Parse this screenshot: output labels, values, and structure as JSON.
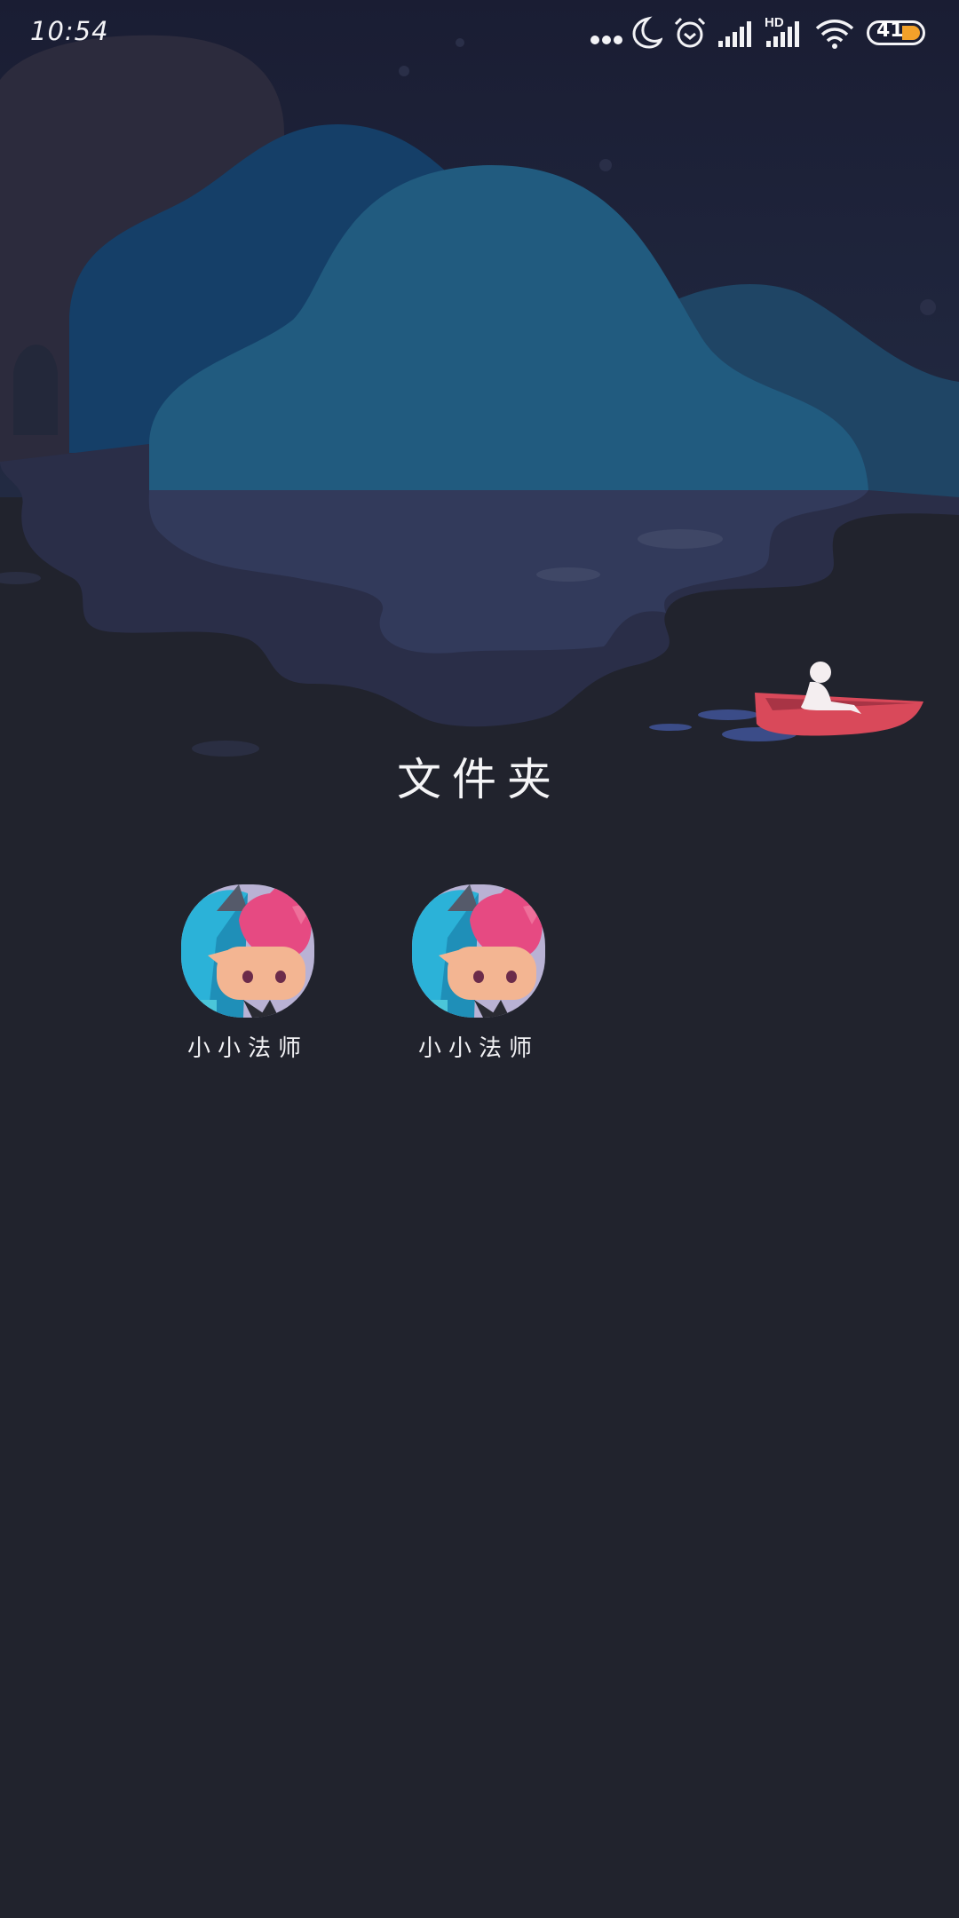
{
  "status_bar": {
    "time": "10:54",
    "network_label": "HD",
    "battery_level": "41",
    "battery_color": "#f2a12a",
    "icons": [
      "more-dots-icon",
      "do-not-disturb-moon-icon",
      "alarm-icon",
      "cell-signal-icon",
      "cell-signal-hd-icon",
      "wifi-icon",
      "battery-icon"
    ]
  },
  "folder": {
    "title": "文件夹",
    "apps": [
      {
        "label": "小小法师",
        "icon": "little-mage-app-icon"
      },
      {
        "label": "小小法师",
        "icon": "little-mage-app-icon"
      }
    ]
  },
  "colors": {
    "background": "#21232d",
    "wallpaper_sky": "#1c1f33",
    "mountain_front": "#215b7f",
    "boat": "#d9495a"
  }
}
